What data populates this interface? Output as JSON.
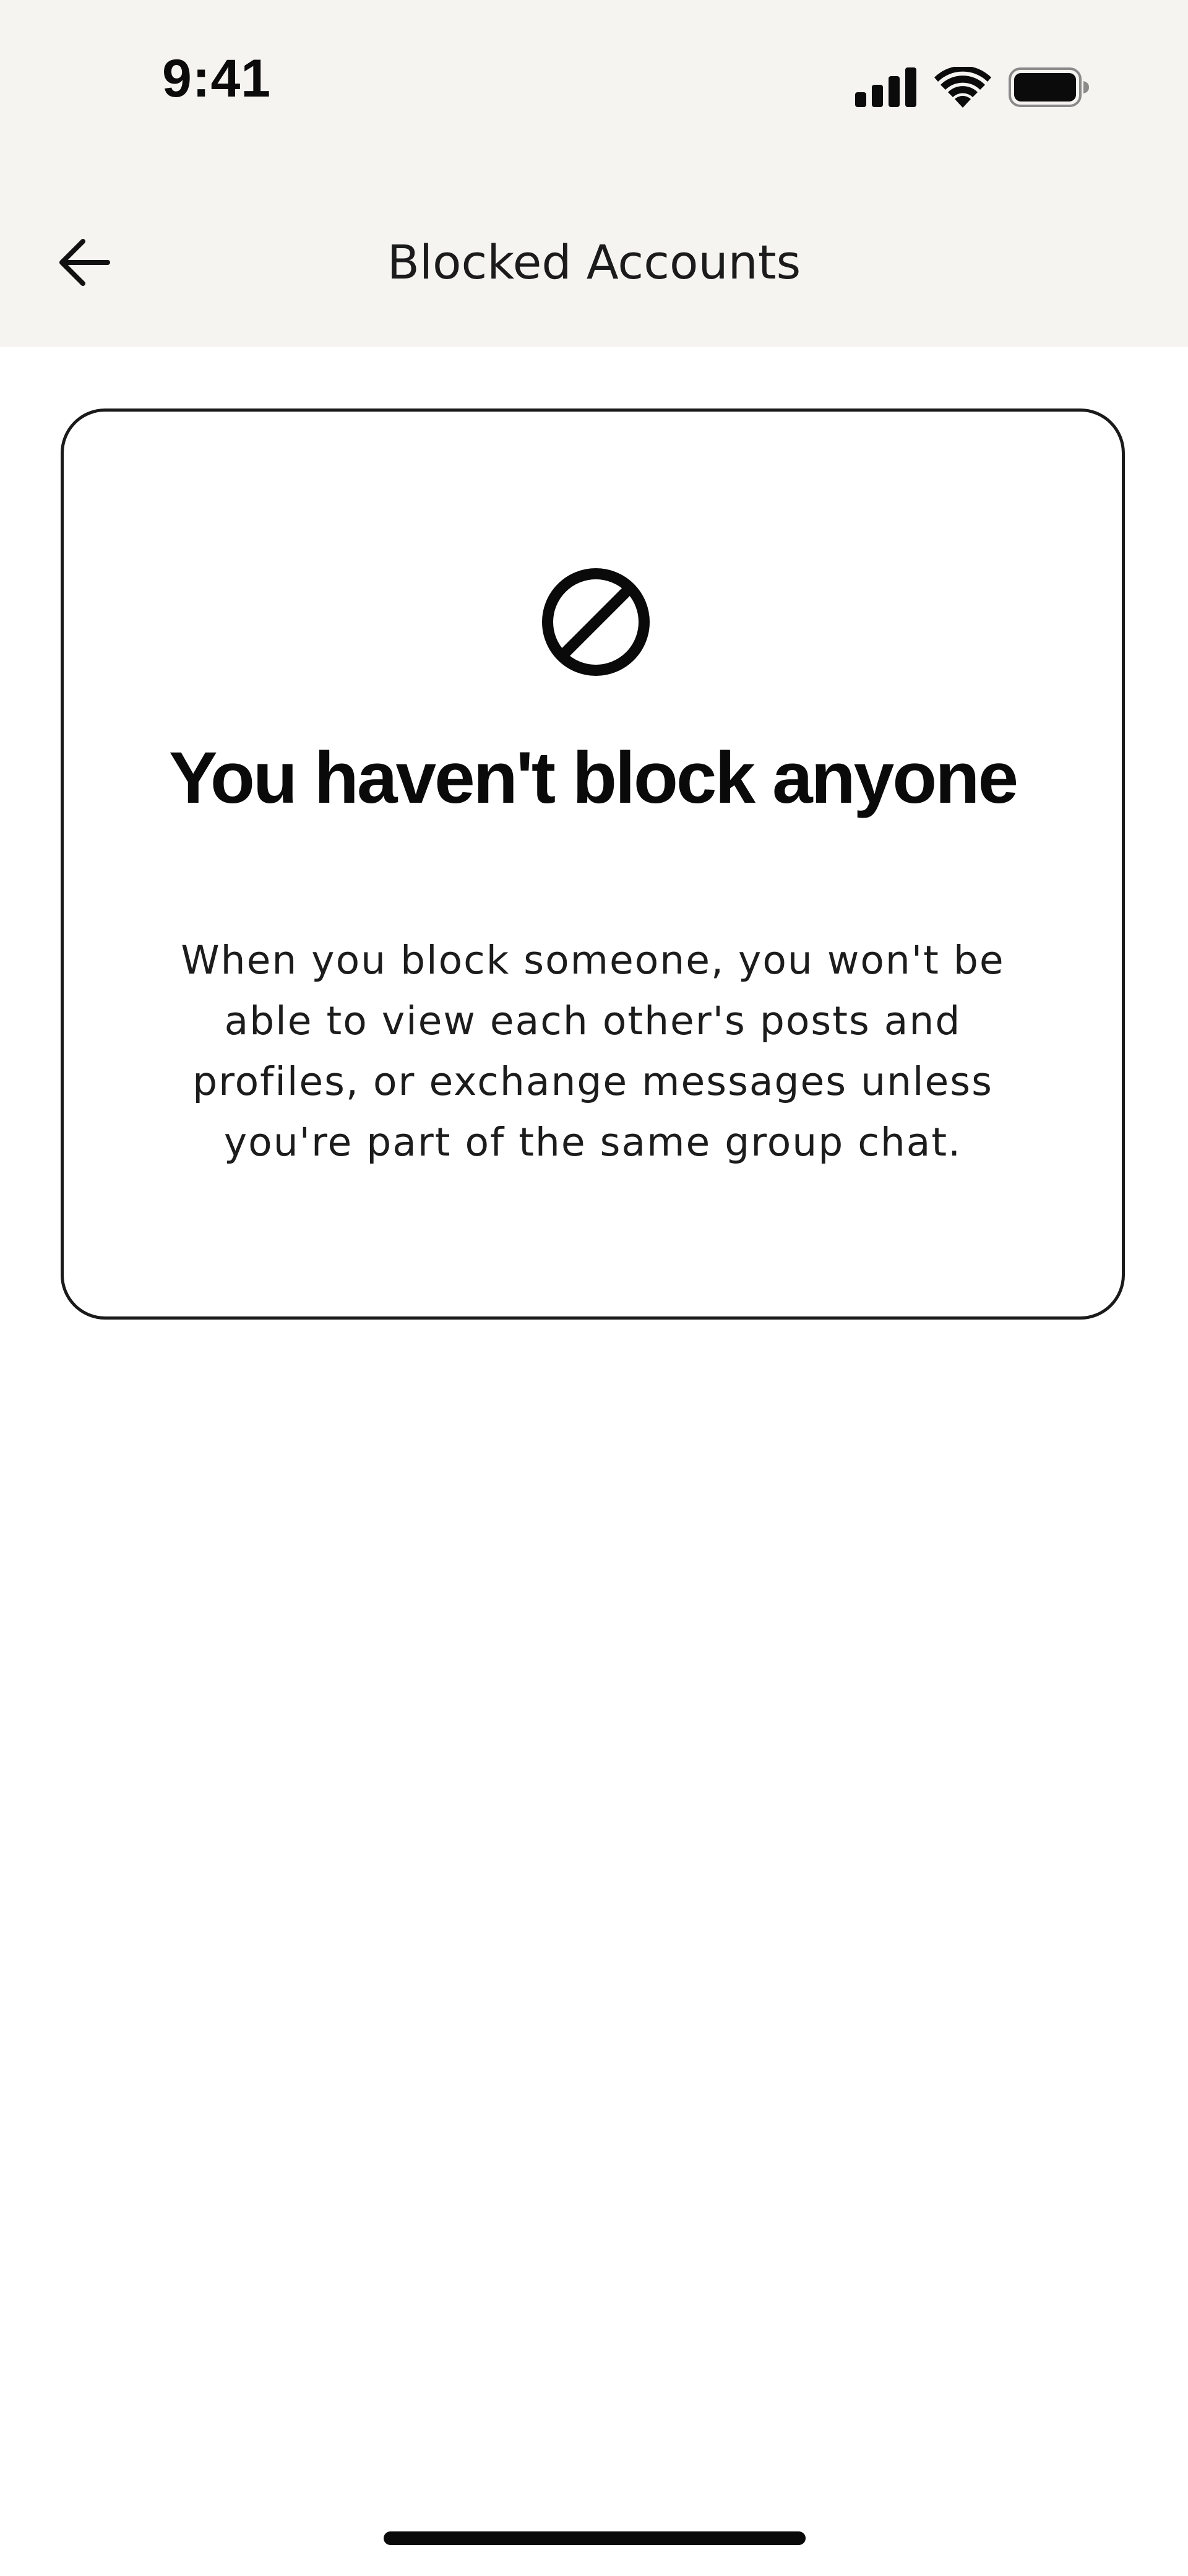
{
  "status_bar": {
    "time": "9:41",
    "icons": [
      "signal-icon",
      "wifi-icon",
      "battery-icon"
    ]
  },
  "nav": {
    "title": "Blocked Accounts",
    "back_icon": "arrow-left-icon"
  },
  "empty_state": {
    "icon": "block-icon",
    "title": "You haven't block anyone",
    "description": "When you block someone, you won't be able to view each other's posts and profiles, or exchange messages unless you're part of the same group chat."
  },
  "colors": {
    "header_background": "#f5f4f1",
    "page_background": "#ffffff",
    "text": "#111111",
    "card_border": "#1a1a1a"
  }
}
